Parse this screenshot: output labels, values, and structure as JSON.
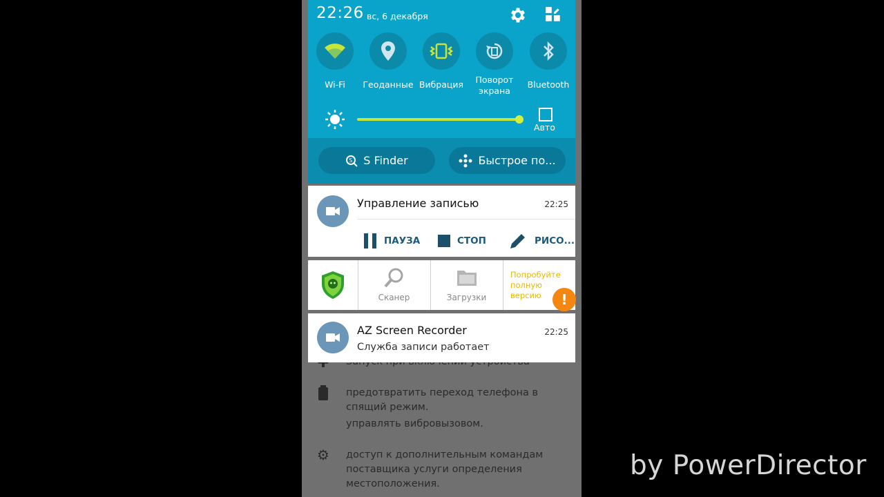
{
  "status": {
    "time": "22:26",
    "date": "вс, 6 декабря"
  },
  "quick_toggles": [
    {
      "label": "Wi-Fi",
      "icon": "wifi-icon",
      "active": true
    },
    {
      "label": "Геоданные",
      "icon": "location-pin-icon",
      "active": false
    },
    {
      "label": "Вибрация",
      "icon": "vibration-icon",
      "active": true
    },
    {
      "label": "Поворот экрана",
      "icon": "screen-rotate-icon",
      "active": false
    },
    {
      "label": "Bluetooth",
      "icon": "bluetooth-icon",
      "active": false
    }
  ],
  "brightness": {
    "level_percent": 98,
    "auto_label": "Авто",
    "auto_checked": false
  },
  "quick_buttons": {
    "s_finder": "S Finder",
    "quick_connect": "Быстрое по..."
  },
  "notifications": {
    "recording_control": {
      "title": "Управление записью",
      "time": "22:25",
      "actions": {
        "pause": "ПАУЗА",
        "stop": "СТОП",
        "draw": "РИСО..."
      }
    },
    "drweb": {
      "scanner": "Сканер",
      "downloads": "Загрузки",
      "promo": "Попробуйте полную версию"
    },
    "az_recorder": {
      "title": "AZ Screen Recorder",
      "time": "22:25",
      "subtitle": "Служба записи работает"
    }
  },
  "background": {
    "row_partial": "Запуск при включении устройства",
    "row1_line1": "предотвратить переход телефона в",
    "row1_line2": "спящий режим.",
    "row1_line3": "управлять вибровызовом.",
    "row2_line1": "доступ к дополнительным командам",
    "row2_line2": "поставщика услуги определения",
    "row2_line3": "местоположения."
  },
  "watermark": "by PowerDirector",
  "colors": {
    "shade": "#0aa3c9",
    "accent_green": "#c8e63a",
    "avatar": "#6c96b7",
    "action_text": "#1b5b79"
  }
}
